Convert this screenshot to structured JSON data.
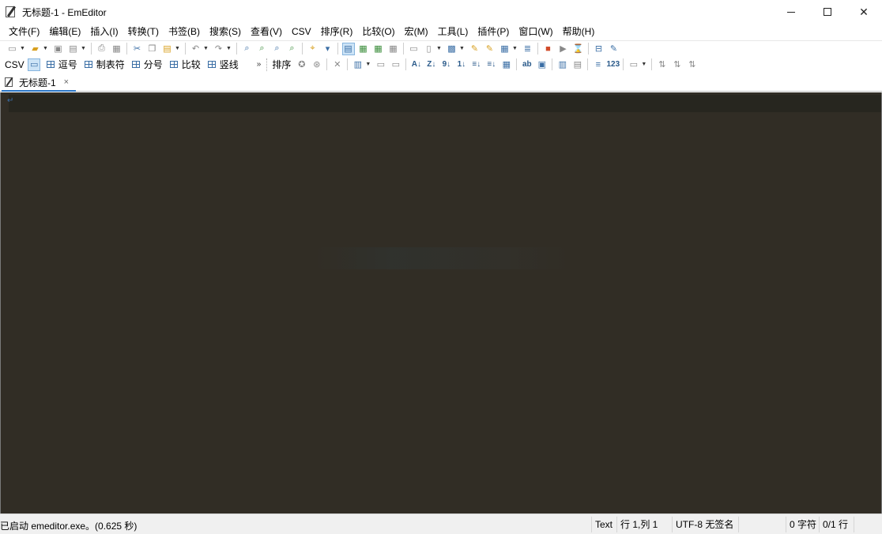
{
  "window": {
    "title": "无标题-1 - EmEditor",
    "controls": [
      "minimize",
      "maximize",
      "close"
    ]
  },
  "menu": [
    "文件(F)",
    "编辑(E)",
    "插入(I)",
    "转换(T)",
    "书签(B)",
    "搜索(S)",
    "查看(V)",
    "CSV",
    "排序(R)",
    "比较(O)",
    "宏(M)",
    "工具(L)",
    "插件(P)",
    "窗口(W)",
    "帮助(H)"
  ],
  "csv_toolbar": {
    "label": "CSV",
    "modes": [
      "逗号",
      "制表符",
      "分号",
      "比较",
      "竖线"
    ],
    "more": "»",
    "sort_label": "排序"
  },
  "tabs": [
    {
      "label": "无标题-1",
      "close": "×"
    }
  ],
  "editor": {
    "eol_mark": "↵",
    "background": "#312d25"
  },
  "statusbar": {
    "message": "已启动 emeditor.exe。(0.625 秒)",
    "mode": "Text",
    "position": "行 1,列 1",
    "encoding": "UTF-8 无签名",
    "chars": "0 字符",
    "lines": "0/1 行"
  },
  "colors": {
    "accent": "#2a76c6",
    "editor_bg": "#312d25",
    "current_line_bg": "#27261f"
  }
}
